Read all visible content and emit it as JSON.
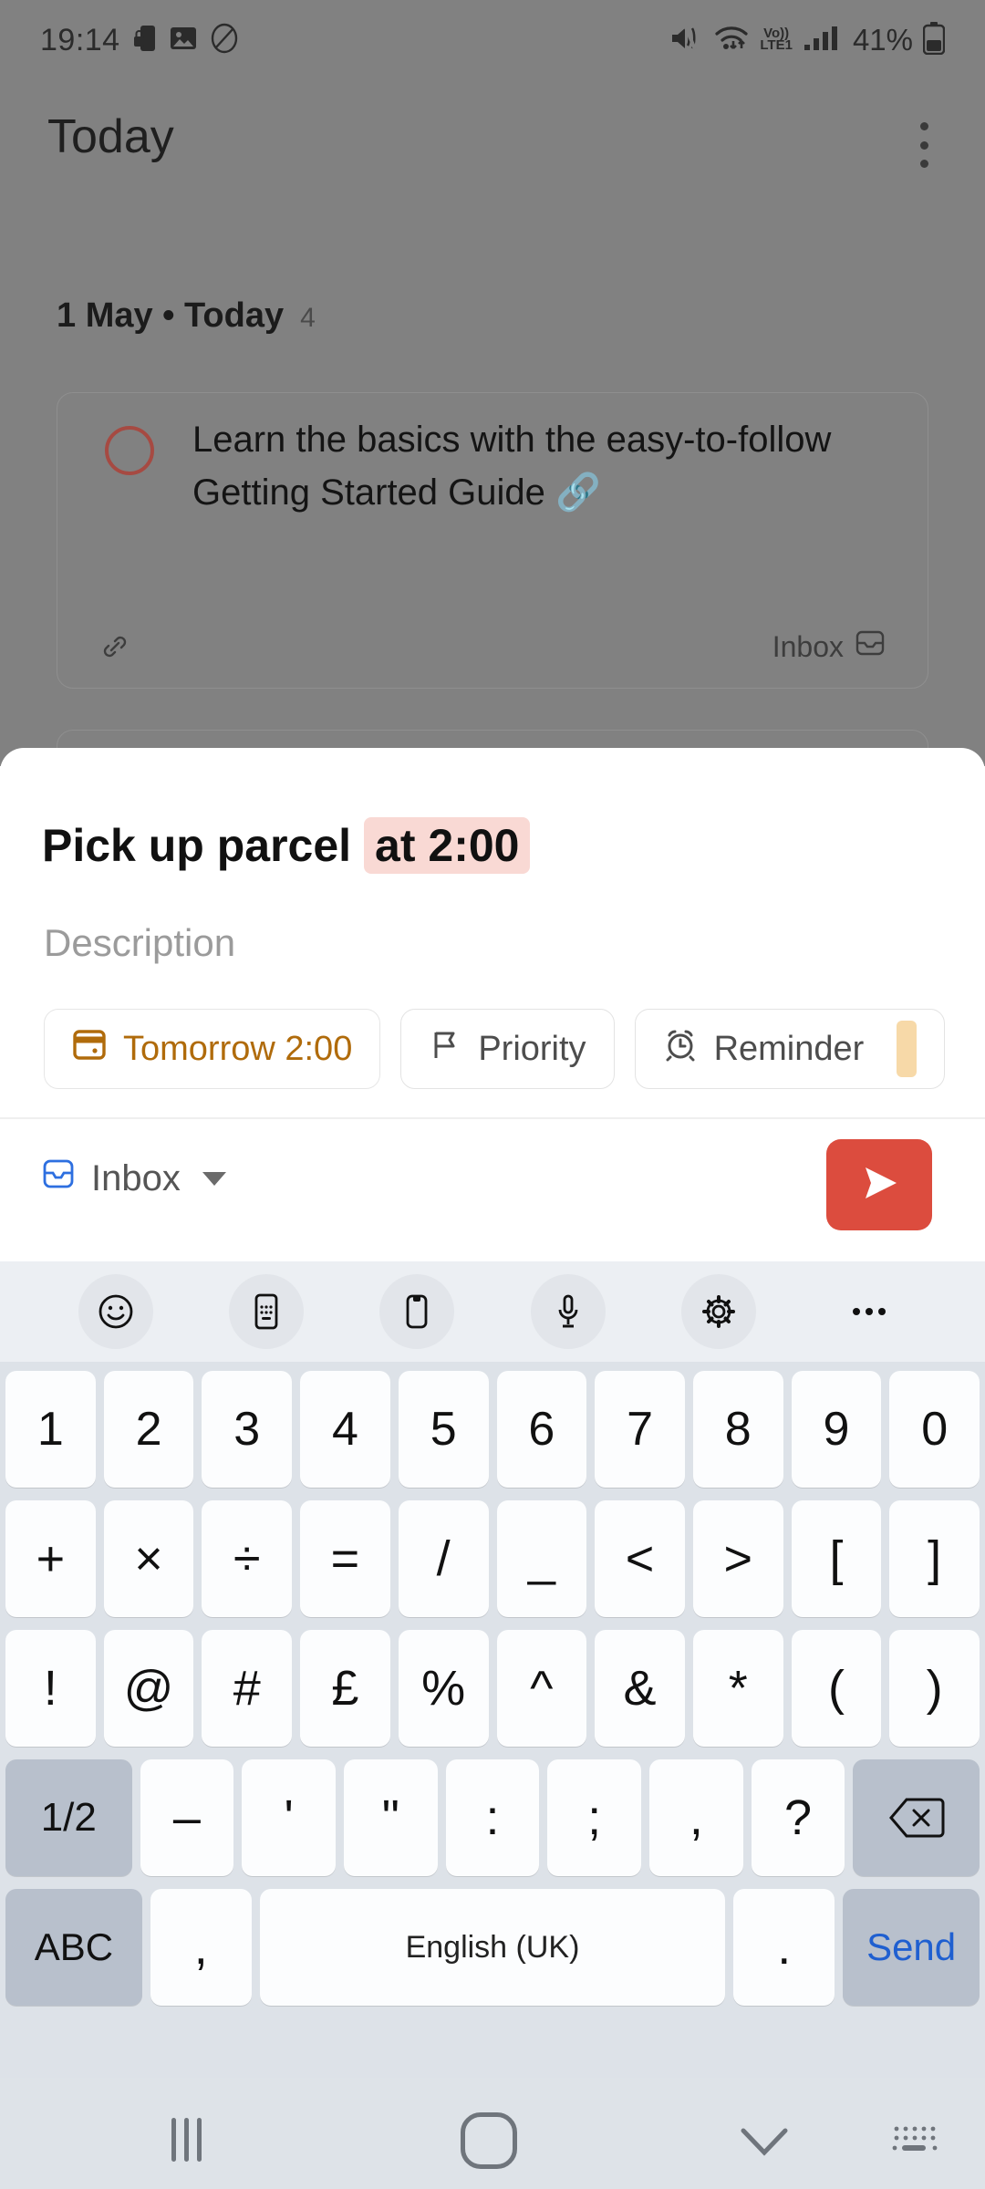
{
  "status_bar": {
    "time": "19:14",
    "battery_percent": "41%",
    "volte_top": "Vo))",
    "volte_bottom": "LTE1",
    "icons": [
      "lock-phone-icon",
      "image-icon",
      "no-sim-icon",
      "mute-icon",
      "wifi-icon",
      "volte-icon",
      "signal-icon",
      "battery-icon"
    ]
  },
  "app": {
    "title": "Today",
    "overflow_menu": "kebab-menu-icon",
    "section": {
      "title": "1 May • Today",
      "count": "4"
    },
    "tasks": [
      {
        "text": "Learn the basics with the easy-to-follow Getting Started Guide 🔗",
        "meta_left_icon": "link-icon",
        "project": "Inbox",
        "project_icon": "inbox-icon"
      }
    ]
  },
  "sheet": {
    "title_plain": "Pick up parcel",
    "title_highlight": "at 2:00",
    "description_placeholder": "Description",
    "chips": [
      {
        "label": "Tomorrow 2:00",
        "icon": "calendar-icon",
        "active": true
      },
      {
        "label": "Priority",
        "icon": "flag-icon",
        "active": false
      },
      {
        "label": "Reminder",
        "icon": "alarm-clock-icon",
        "active": false
      }
    ],
    "project": {
      "label": "Inbox",
      "icon": "inbox-icon"
    },
    "send_button": "send-icon"
  },
  "colors": {
    "accent_red": "#dc4c3e",
    "date_amber": "#b06b0b",
    "highlight_pink": "#f9d9d4",
    "send_key_blue": "#1f5fd0"
  },
  "keyboard": {
    "toolbar": [
      "emoji-icon",
      "keypad-icon",
      "clipboard-icon",
      "microphone-icon",
      "settings-gear-icon",
      "more-options-icon"
    ],
    "rows": [
      [
        "1",
        "2",
        "3",
        "4",
        "5",
        "6",
        "7",
        "8",
        "9",
        "0"
      ],
      [
        "+",
        "×",
        "÷",
        "=",
        "/",
        "_",
        "<",
        ">",
        "[",
        "]"
      ],
      [
        "!",
        "@",
        "#",
        "£",
        "%",
        "^",
        "&",
        "*",
        "(",
        ")"
      ],
      [
        "1/2",
        "–",
        "'",
        "\"",
        ":",
        ";",
        ",",
        "?",
        "backspace-icon"
      ]
    ],
    "bottom_row": {
      "abc": "ABC",
      "comma": ",",
      "space": "English (UK)",
      "period": ".",
      "send": "Send"
    }
  },
  "nav_bar": {
    "recents": "recents-icon",
    "home": "home-icon",
    "hide_keyboard": "chevron-down-icon",
    "switch_keyboard": "keyboard-switch-icon"
  }
}
